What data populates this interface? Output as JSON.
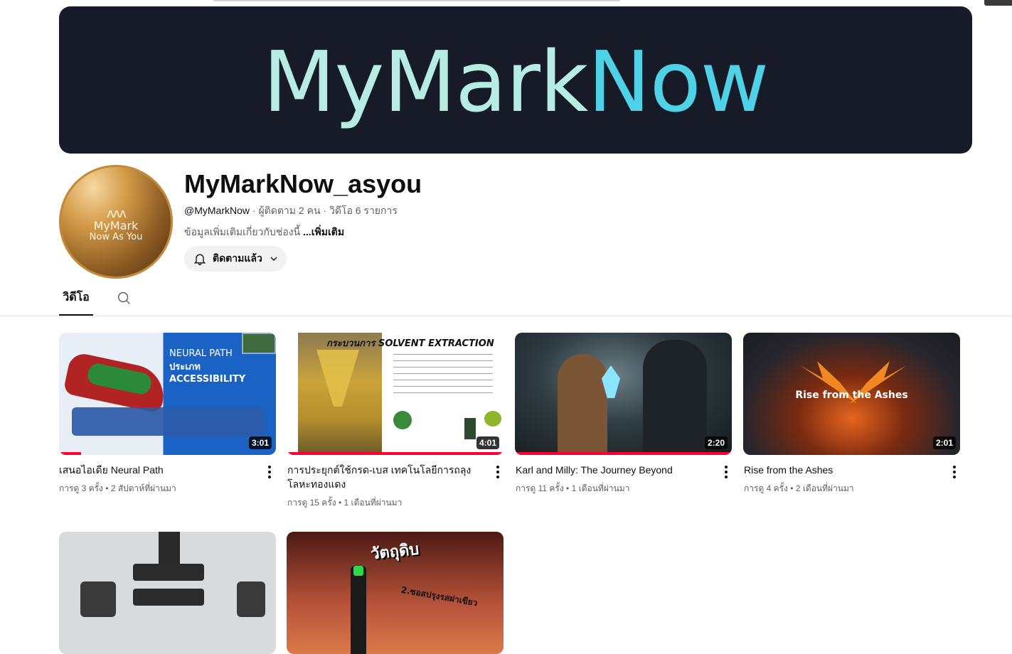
{
  "banner": {
    "text_part1": "MyMark",
    "text_part2": "Now"
  },
  "avatar": {
    "line1": "MyMark",
    "line2": "Now As You"
  },
  "channel": {
    "name": "MyMarkNow_asyou",
    "handle": "@MyMarkNow",
    "subscribers": "ผู้ติดตาม 2 คน",
    "video_count": "วิดีโอ 6 รายการ",
    "description": "ข้อมูลเพิ่มเติมเกี่ยวกับช่องนี้",
    "more_label": "...เพิ่มเติม",
    "subscribe_label": "ติดตามแล้ว"
  },
  "tabs": {
    "videos_label": "วิดีโอ"
  },
  "videos": [
    {
      "title": "เสนอไอเดีย Neural Path",
      "views": "การดู 3 ครั้ง",
      "age": "2 สัปดาห์ที่ผ่านมา",
      "duration": "3:01",
      "thumb_head": "NEURAL PATH",
      "thumb_sub": "ประเภท ACCESSIBILITY",
      "watched": 0.1
    },
    {
      "title": "การประยุกต์ใช้กรด-เบส เทคโนโลยีการถลุงโลหะทองแดง",
      "views": "การดู 15 ครั้ง",
      "age": "1 เดือนที่ผ่านมา",
      "duration": "4:01",
      "thumb_head": "กระบวนการ SOLVENT EXTRACTION",
      "watched": 1.0
    },
    {
      "title": "Karl and Milly: The Journey Beyond",
      "views": "การดู 11 ครั้ง",
      "age": "1 เดือนที่ผ่านมา",
      "duration": "2:20",
      "watched": 1.0
    },
    {
      "title": "Rise from the Ashes",
      "views": "การดู 4 ครั้ง",
      "age": "2 เดือนที่ผ่านมา",
      "duration": "2:01",
      "thumb_head": "Rise from the Ashes",
      "watched": 0
    },
    {
      "thumb_head": ""
    },
    {
      "thumb_head": "วัตถุดิบ",
      "thumb_sub": "2.ซอสปรุงรสฝาเขียว"
    }
  ],
  "meta_separator": "•",
  "dot_separator": "·"
}
